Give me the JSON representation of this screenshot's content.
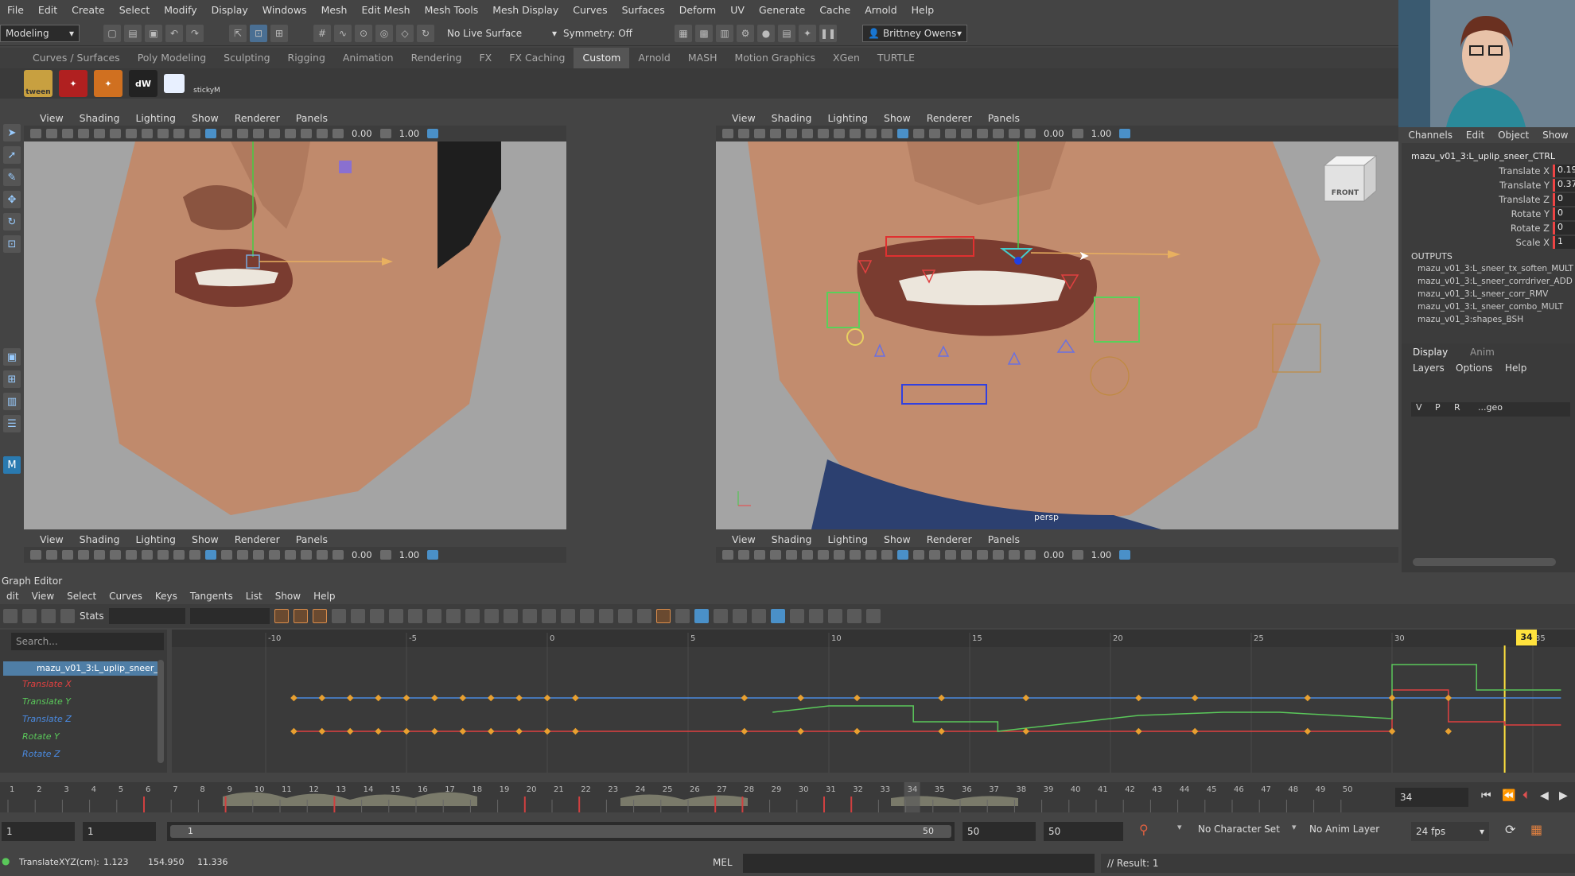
{
  "menubar": [
    "File",
    "Edit",
    "Create",
    "Select",
    "Modify",
    "Display",
    "Windows",
    "Mesh",
    "Edit Mesh",
    "Mesh Tools",
    "Mesh Display",
    "Curves",
    "Surfaces",
    "Deform",
    "UV",
    "Generate",
    "Cache",
    "Arnold",
    "Help"
  ],
  "toolbar": {
    "workspace": "Modeling",
    "live_surface": "No Live Surface",
    "symmetry": "Symmetry: Off",
    "user": "Brittney Owens"
  },
  "shelf_tabs": [
    "Curves / Surfaces",
    "Poly Modeling",
    "Sculpting",
    "Rigging",
    "Animation",
    "Rendering",
    "FX",
    "FX Caching",
    "Custom",
    "Arnold",
    "MASH",
    "Motion Graphics",
    "XGen",
    "TURTLE"
  ],
  "shelf_active": "Custom",
  "shelf_buttons": [
    "tween",
    "",
    "",
    "dW",
    "",
    "stickyM"
  ],
  "viewport_menu": [
    "View",
    "Shading",
    "Lighting",
    "Show",
    "Renderer",
    "Panels"
  ],
  "viewport_values": {
    "exposure": "0.00",
    "gamma": "1.00"
  },
  "viewcube_label": "FRONT",
  "camera_label": "persp",
  "channels": {
    "menu": [
      "Channels",
      "Edit",
      "Object",
      "Show"
    ],
    "node": "mazu_v01_3:L_uplip_sneer_CTRL",
    "attrs": [
      {
        "name": "Translate X",
        "value": "0.19"
      },
      {
        "name": "Translate Y",
        "value": "0.37"
      },
      {
        "name": "Translate Z",
        "value": "0"
      },
      {
        "name": "Rotate Y",
        "value": "0"
      },
      {
        "name": "Rotate Z",
        "value": "0"
      },
      {
        "name": "Scale X",
        "value": "1"
      }
    ],
    "outputs_label": "OUTPUTS",
    "outputs": [
      "mazu_v01_3:L_sneer_tx_soften_MULT",
      "mazu_v01_3:L_sneer_corrdriver_ADD",
      "mazu_v01_3:L_sneer_corr_RMV",
      "mazu_v01_3:L_sneer_combo_MULT",
      "mazu_v01_3:shapes_BSH"
    ]
  },
  "layers": {
    "tabs": [
      "Display",
      "Anim"
    ],
    "menu": [
      "Layers",
      "Options",
      "Help"
    ],
    "row": [
      "V",
      "P",
      "R",
      "...geo"
    ]
  },
  "graph_editor": {
    "title": "Graph Editor",
    "menu": [
      "dit",
      "View",
      "Select",
      "Curves",
      "Keys",
      "Tangents",
      "List",
      "Show",
      "Help"
    ],
    "stats_label": "Stats",
    "search_placeholder": "Search...",
    "node": "mazu_v01_3:L_uplip_sneer_",
    "curves": [
      {
        "name": "Translate X",
        "color": "#e04040"
      },
      {
        "name": "Translate Y",
        "color": "#5ac85a"
      },
      {
        "name": "Translate Z",
        "color": "#4a8ae0"
      },
      {
        "name": "Rotate Y",
        "color": "#5ac85a"
      },
      {
        "name": "Rotate Z",
        "color": "#4a8ae0"
      }
    ],
    "ruler": [
      "-10",
      "-5",
      "0",
      "5",
      "10",
      "15",
      "20",
      "25",
      "30",
      "35"
    ],
    "current_frame": "34"
  },
  "timeline": {
    "ticks": [
      "1",
      "2",
      "3",
      "4",
      "5",
      "6",
      "7",
      "8",
      "9",
      "10",
      "11",
      "12",
      "13",
      "14",
      "15",
      "16",
      "17",
      "18",
      "19",
      "20",
      "21",
      "22",
      "23",
      "24",
      "25",
      "26",
      "27",
      "28",
      "29",
      "30",
      "31",
      "32",
      "33",
      "34",
      "35",
      "36",
      "37",
      "38",
      "39",
      "40",
      "41",
      "42",
      "43",
      "44",
      "45",
      "46",
      "47",
      "48",
      "49",
      "50"
    ],
    "current": "34"
  },
  "range": {
    "start": "1",
    "start2": "1",
    "slider_start": "1",
    "slider_end": "50",
    "end": "50",
    "end2": "50",
    "character_set": "No Character Set",
    "anim_layer": "No Anim Layer",
    "fps": "24 fps"
  },
  "status": {
    "coords_label": "TranslateXYZ(cm):",
    "x": "1.123",
    "y": "154.950",
    "z": "11.336",
    "mel": "MEL",
    "result": "// Result: 1"
  }
}
